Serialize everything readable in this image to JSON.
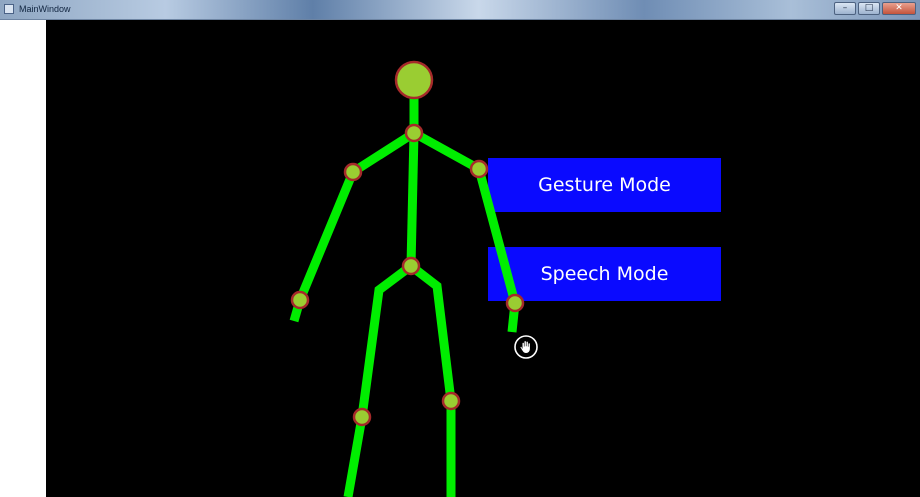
{
  "window": {
    "title": "MainWindow",
    "controls": {
      "minimize_glyph": "–",
      "maximize_glyph": "□",
      "close_glyph": "✕"
    }
  },
  "buttons": {
    "gesture_mode": "Gesture Mode",
    "speech_mode": "Speech Mode"
  },
  "colors": {
    "canvas_background": "#000000",
    "bone": "#00ee00",
    "joint_fill": "#9acd32",
    "joint_stroke": "#a52a2a",
    "button_background": "#0a0aff",
    "button_text": "#ffffff"
  },
  "icons": {
    "cursor": "hand-cursor-icon",
    "app": "window-app-icon"
  }
}
